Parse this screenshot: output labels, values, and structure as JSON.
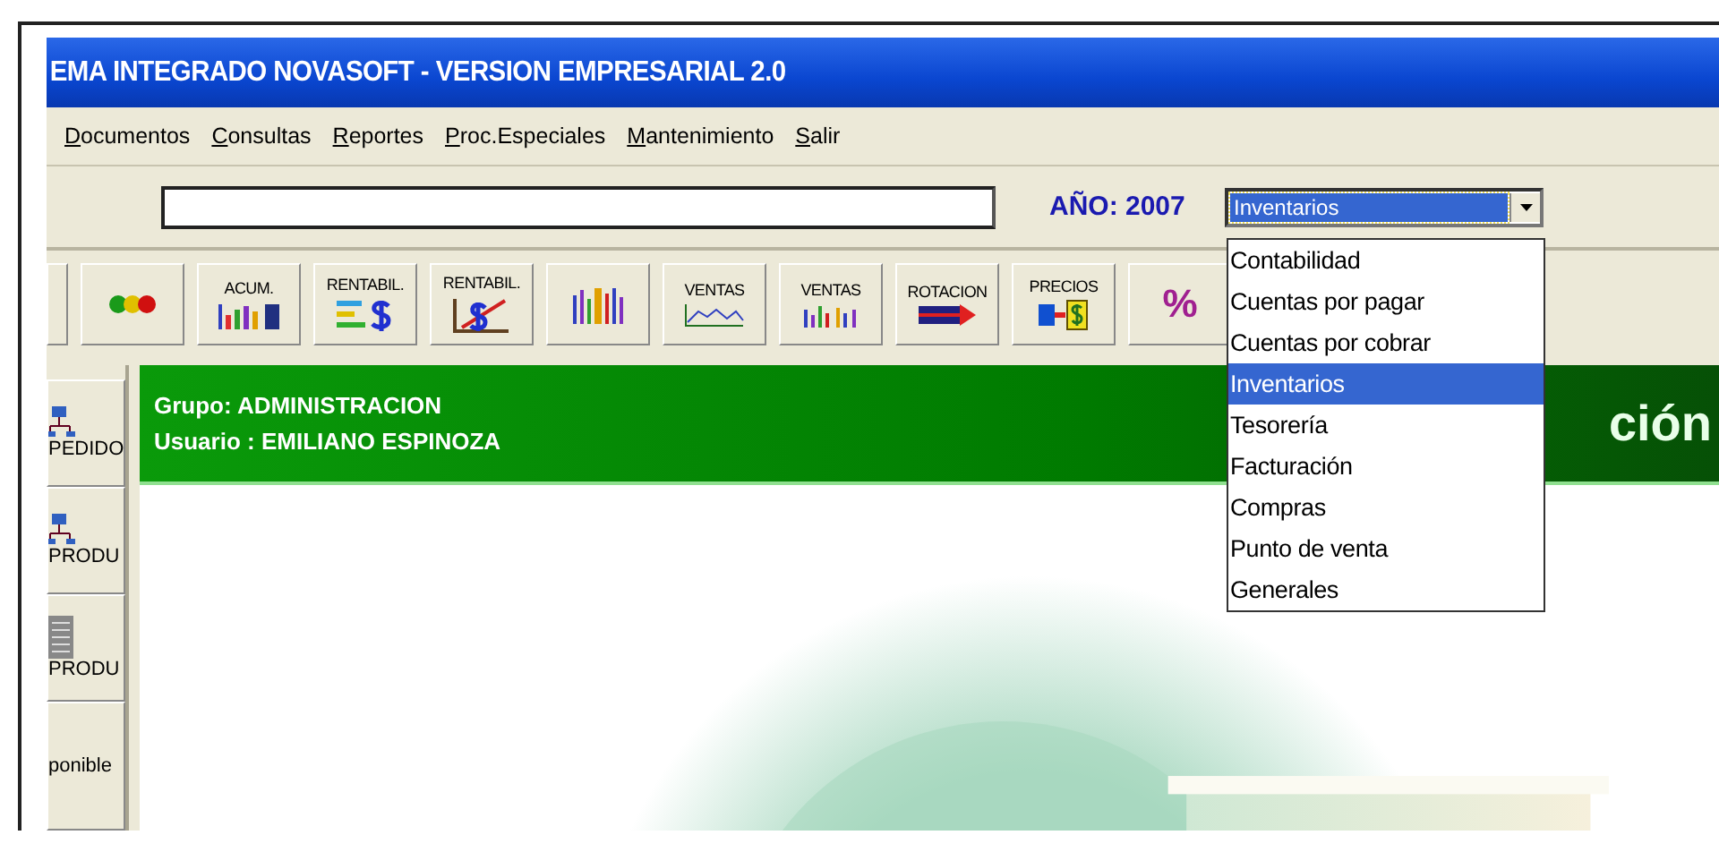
{
  "window": {
    "title": "EMA INTEGRADO NOVASOFT - VERSION EMPRESARIAL 2.0"
  },
  "menu": [
    "Documentos",
    "Consultas",
    "Reportes",
    "Proc.Especiales",
    "Mantenimiento",
    "Salir"
  ],
  "address_row": {
    "year_label": "AÑO: 2007",
    "module_select": {
      "value": "Inventarios",
      "expanded": true,
      "options": [
        {
          "label": "Contabilidad",
          "selected": false
        },
        {
          "label": "Cuentas por pagar",
          "selected": false
        },
        {
          "label": "Cuentas por cobrar",
          "selected": false
        },
        {
          "label": "Inventarios",
          "selected": true
        },
        {
          "label": "Tesorería",
          "selected": false
        },
        {
          "label": "Facturación",
          "selected": false
        },
        {
          "label": "Compras",
          "selected": false
        },
        {
          "label": "Punto de venta",
          "selected": false
        },
        {
          "label": "Generales",
          "selected": false
        }
      ]
    }
  },
  "toolbar": [
    {
      "kind": "blank"
    },
    {
      "kind": "dots"
    },
    {
      "kind": "bars",
      "label": "ACUM."
    },
    {
      "kind": "money",
      "label": "RENTABIL."
    },
    {
      "kind": "trend",
      "label": "RENTABIL."
    },
    {
      "kind": "columns"
    },
    {
      "kind": "line",
      "label": "VENTAS"
    },
    {
      "kind": "bars2",
      "label": "VENTAS"
    },
    {
      "kind": "arrow",
      "label": "ROTACION"
    },
    {
      "kind": "price",
      "label": "PRECIOS"
    },
    {
      "kind": "glyph",
      "label": "%"
    }
  ],
  "sidebar": [
    {
      "kind": "tree",
      "label": "PEDIDO"
    },
    {
      "kind": "tree",
      "label": "PRODU"
    },
    {
      "kind": "sheet",
      "label": "PRODU"
    },
    {
      "kind": "text",
      "label": "ponible"
    }
  ],
  "banner": {
    "group": "Grupo: ADMINISTRACION",
    "user": "Usuario : EMILIANO ESPINOZA",
    "heading": "ción"
  }
}
